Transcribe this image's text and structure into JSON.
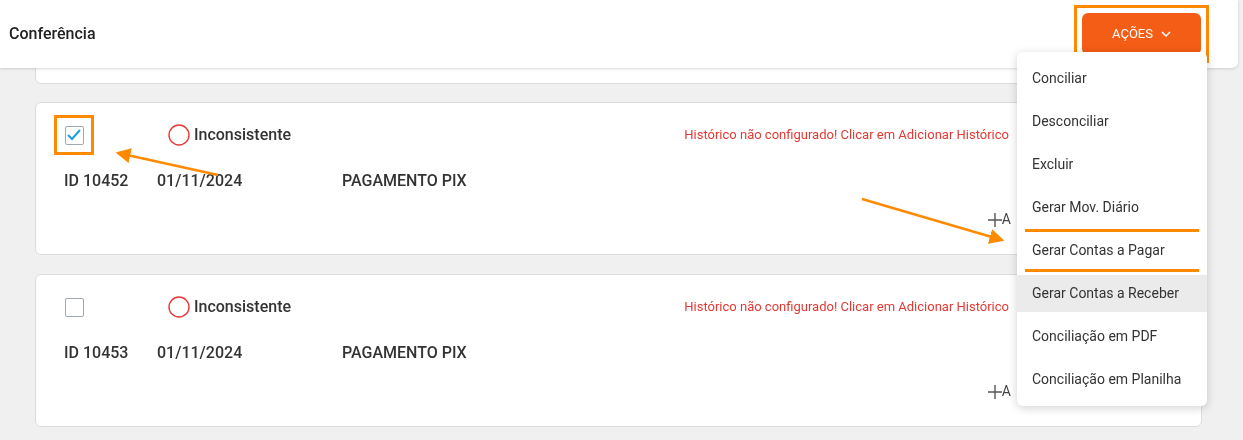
{
  "header": {
    "title": "Conferência",
    "actions_button": {
      "label": "AÇÕES",
      "annotated": true
    }
  },
  "cards": [
    {
      "checked": true,
      "annotated": true,
      "status": "Inconsistente",
      "warning": "Histórico não configurado! Clicar em Adicionar Histórico",
      "id": "ID 10452",
      "date": "01/11/2024",
      "description": "PAGAMENTO PIX",
      "add_label": "A"
    },
    {
      "checked": false,
      "annotated": false,
      "status": "Inconsistente",
      "warning": "Histórico não configurado! Clicar em Adicionar Histórico",
      "id": "ID 10453",
      "date": "01/11/2024",
      "description": "PAGAMENTO PIX",
      "add_label": "A"
    }
  ],
  "menu": {
    "items": [
      {
        "label": "Conciliar",
        "hovered": false,
        "annotated": false
      },
      {
        "label": "Desconciliar",
        "hovered": false,
        "annotated": false
      },
      {
        "label": "Excluir",
        "hovered": false,
        "annotated": false
      },
      {
        "label": "Gerar Mov. Diário",
        "hovered": false,
        "annotated": false
      },
      {
        "label": "Gerar Contas a Pagar",
        "hovered": false,
        "annotated": true
      },
      {
        "label": "Gerar Contas a Receber",
        "hovered": true,
        "annotated": false
      },
      {
        "label": "Conciliação em PDF",
        "hovered": false,
        "annotated": false
      },
      {
        "label": "Conciliação em Planilha",
        "hovered": false,
        "annotated": false
      }
    ]
  }
}
